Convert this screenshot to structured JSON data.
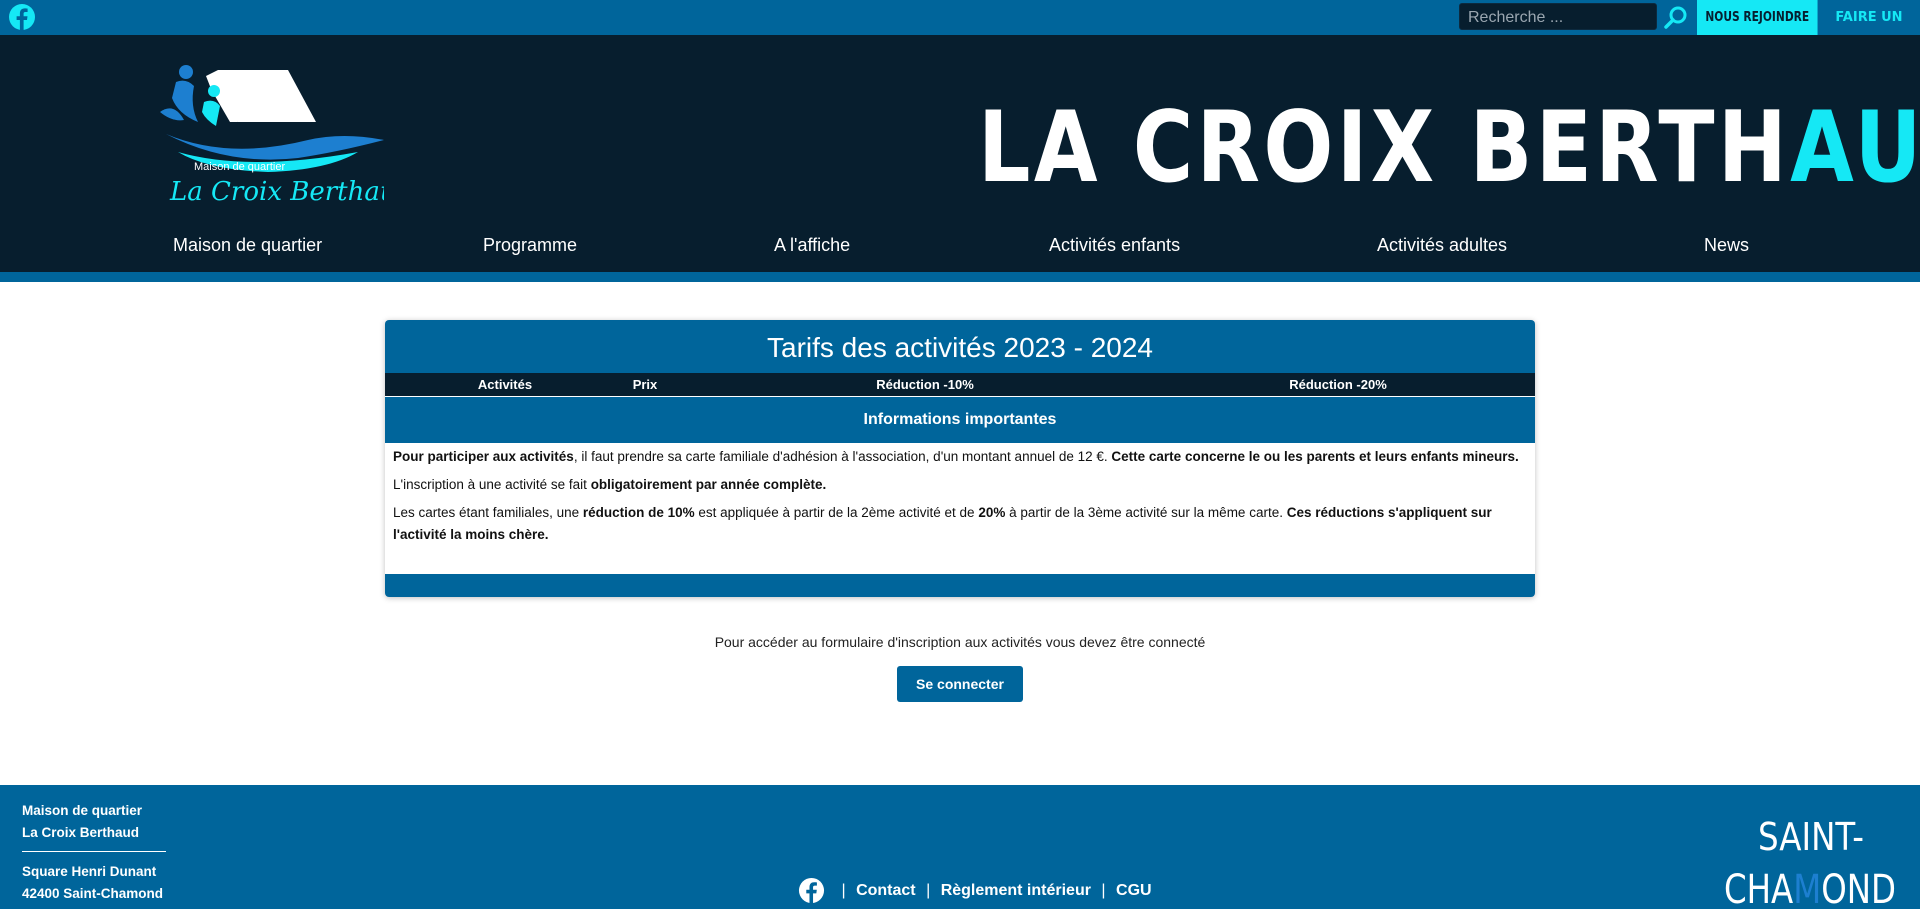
{
  "topbar": {
    "search_placeholder": "Recherche ...",
    "join_label": "NOUS REJOINDRE",
    "donate_label": "FAIRE UN DON"
  },
  "header": {
    "logo_small": "Maison de quartier",
    "logo_script": "La Croix Berthaud",
    "title_main": "LA CROIX BERTH",
    "title_accent": "AUD"
  },
  "nav": [
    {
      "label": "Maison de quartier"
    },
    {
      "label": "Programme"
    },
    {
      "label": "A l'affiche"
    },
    {
      "label": "Activités enfants"
    },
    {
      "label": "Activités adultes"
    },
    {
      "label": "News"
    }
  ],
  "card": {
    "title": "Tarifs des activités 2023 - 2024",
    "columns": [
      "Activités",
      "Prix",
      "Réduction -10%",
      "Réduction -20%"
    ],
    "info_title": "Informations importantes",
    "p1": {
      "b1": "Pour participer aux activités",
      "t1": ", il faut prendre sa carte familiale d'adhésion à l'association, d'un montant annuel de 12 €. ",
      "b2": "Cette carte concerne le ou les parents et leurs enfants mineurs."
    },
    "p2": {
      "t1": "L'inscription à une activité se fait ",
      "b1": "obligatoirement par année complète."
    },
    "p3": {
      "t1": "Les cartes étant familiales, une ",
      "b1": "réduction de 10%",
      "t2": " est appliquée à partir de la 2ème activité et de ",
      "b2": "20%",
      "t3": " à partir de la 3ème activité sur la même carte. ",
      "b3": "Ces réductions s'appliquent sur l'activité la moins chère."
    }
  },
  "login": {
    "text": "Pour accéder au formulaire d'inscription aux activités vous devez être connecté",
    "button": "Se connecter"
  },
  "footer": {
    "line1": "Maison de quartier",
    "line2": "La Croix Berthaud",
    "line3": "Square Henri Dunant",
    "line4": "42400 Saint-Chamond",
    "links": [
      "Contact",
      "Règlement intérieur",
      "CGU"
    ],
    "city_top": "SAINT-",
    "city_bottom_a": "CHA",
    "city_bottom_b": "M",
    "city_bottom_c": "OND"
  },
  "colors": {
    "brand_blue": "#00659b",
    "navy": "#071e2e",
    "cyan": "#15e8f5"
  }
}
